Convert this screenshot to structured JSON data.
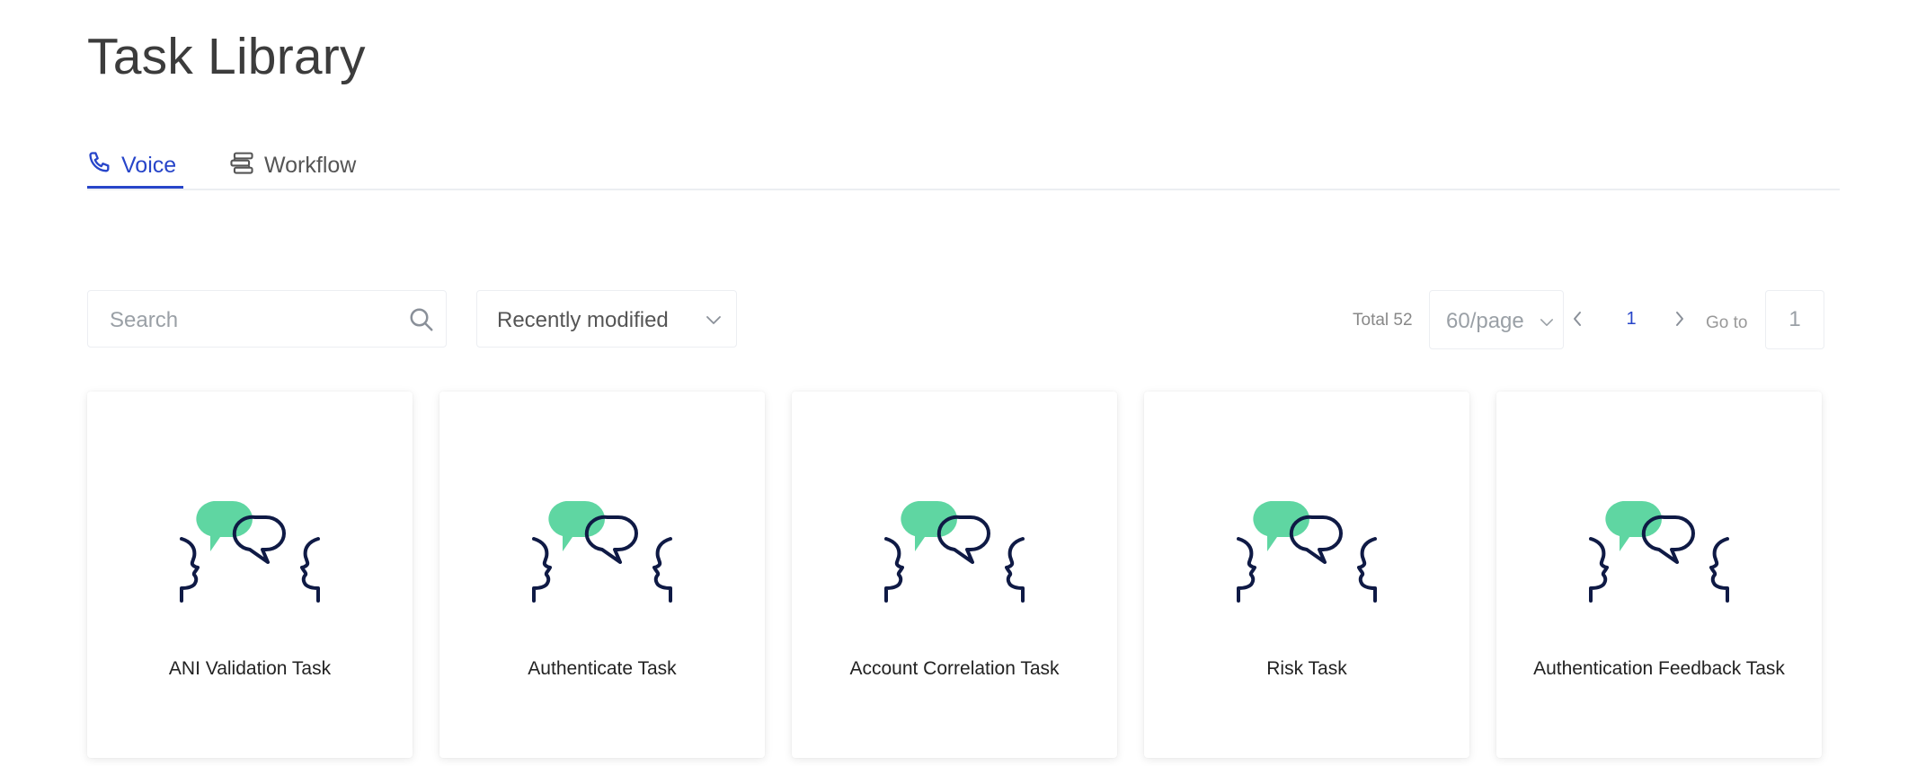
{
  "page": {
    "title": "Task Library"
  },
  "tabs": [
    {
      "label": "Voice",
      "icon": "phone-icon",
      "active": true
    },
    {
      "label": "Workflow",
      "icon": "workflow-icon",
      "active": false
    }
  ],
  "filters": {
    "search_placeholder": "Search",
    "sort_value": "Recently modified"
  },
  "pagination": {
    "total": "Total 52",
    "page_size": "60/page",
    "current_page": "1",
    "goto_label": "Go to",
    "goto_value": "1"
  },
  "cards": [
    {
      "title": "ANI Validation Task"
    },
    {
      "title": "Authenticate Task"
    },
    {
      "title": "Account Correlation Task"
    },
    {
      "title": "Risk Task"
    },
    {
      "title": "Authentication Feedback Task"
    }
  ],
  "colors": {
    "accent": "#2745c9",
    "bubble_green": "#5fd6a2",
    "illustration_stroke": "#0f1a45",
    "border": "#eceef2"
  }
}
